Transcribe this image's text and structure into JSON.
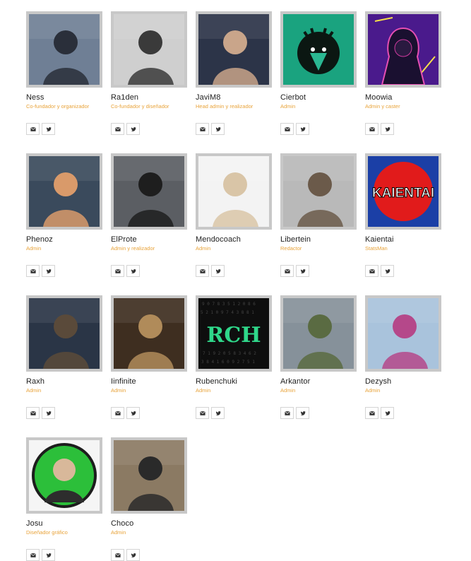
{
  "team": [
    {
      "name": "Ness",
      "role": "Co-fundador y organizador",
      "icon": "person-vr-headset-photo",
      "bg": "#6f7f95",
      "fg": "#2a2f3a"
    },
    {
      "name": "Ra1den",
      "role": "Co-fundador y diseñador",
      "icon": "person-portrait-photo",
      "bg": "#cfcfcf",
      "fg": "#3a3a3a"
    },
    {
      "name": "JaviM8",
      "role": "Head admin y realizador",
      "icon": "person-microphone-photo",
      "bg": "#2c3448",
      "fg": "#c9a58a"
    },
    {
      "name": "Cierbot",
      "role": "Admin",
      "icon": "deer-logo",
      "bg": "#1aa37f",
      "fg": "#0b1712"
    },
    {
      "name": "Moowia",
      "role": "Admin y caster",
      "icon": "neon-hoodie-avatar",
      "bg": "#4a1a8c",
      "fg": "#e64fb3"
    },
    {
      "name": "Phenoz",
      "role": "Admin",
      "icon": "person-esports-photo",
      "bg": "#3a4a5c",
      "fg": "#d99a6a"
    },
    {
      "name": "ElProte",
      "role": "Admin y realizador",
      "icon": "person-portrait-photo",
      "bg": "#5b5e63",
      "fg": "#1e1e1e"
    },
    {
      "name": "Mendocoach",
      "role": "Admin",
      "icon": "person-portrait-photo",
      "bg": "#f3f3f3",
      "fg": "#d9c5a7"
    },
    {
      "name": "Libertein",
      "role": "Redactor",
      "icon": "person-hood-photo",
      "bg": "#b9b9b9",
      "fg": "#6b5a4a"
    },
    {
      "name": "Kaientai",
      "role": "StatsMan",
      "icon": "kaientai-logo",
      "bg": "#1b3fa6",
      "fg": "#e11b1b"
    },
    {
      "name": "Raxh",
      "role": "Admin",
      "icon": "person-gaming-photo",
      "bg": "#2a3546",
      "fg": "#5a4a3a"
    },
    {
      "name": "Iinfinite",
      "role": "Admin",
      "icon": "lan-party-photo",
      "bg": "#3e2e20",
      "fg": "#b08b5a"
    },
    {
      "name": "Rubenchuki",
      "role": "Admin",
      "icon": "rch-graffiti-logo",
      "bg": "#0e0e0e",
      "fg": "#2fd78a"
    },
    {
      "name": "Arkantor",
      "role": "Admin",
      "icon": "person-fountain-photo",
      "bg": "#86919a",
      "fg": "#5a6b42"
    },
    {
      "name": "Dezysh",
      "role": "Admin",
      "icon": "person-back-jersey-photo",
      "bg": "#a9c3dc",
      "fg": "#b5488a"
    },
    {
      "name": "Josu",
      "role": "Diseñador gráfico",
      "icon": "green-circle-avatar",
      "bg": "#f5f5f5",
      "fg": "#2cbf3a"
    },
    {
      "name": "Choco",
      "role": "Admin",
      "icon": "camera-photographer-photo",
      "bg": "#8b7a63",
      "fg": "#2a2a2a"
    }
  ],
  "social_icons": [
    "mail-icon",
    "twitter-icon"
  ],
  "colors": {
    "role": "#e8a33a",
    "frame": "#c8c8c8",
    "button_border": "#d4d4d4"
  }
}
